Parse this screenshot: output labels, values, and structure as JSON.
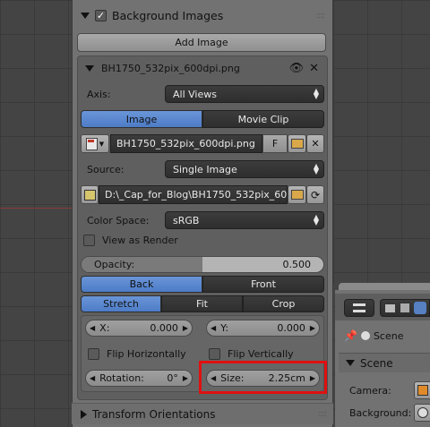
{
  "background_images": {
    "title": "Background Images",
    "add_image_label": "Add Image",
    "image_entry": {
      "filename": "BH1750_532pix_600dpi.png",
      "axis_label": "Axis:",
      "axis_value": "All Views",
      "tab_image": "Image",
      "tab_movie_clip": "Movie Clip",
      "image_name": "BH1750_532pix_600dpi.png",
      "fake_user_label": "F",
      "source_label": "Source:",
      "source_value": "Single Image",
      "filepath": "D:\\_Cap_for_Blog\\BH1750_532pix_600...",
      "color_space_label": "Color Space:",
      "color_space_value": "sRGB",
      "view_as_render_label": "View as Render",
      "opacity_label": "Opacity:",
      "opacity_value": "0.500",
      "opacity_fraction": 0.5,
      "back_label": "Back",
      "front_label": "Front",
      "stretch_label": "Stretch",
      "fit_label": "Fit",
      "crop_label": "Crop",
      "x_label": "X:",
      "x_value": "0.000",
      "y_label": "Y:",
      "y_value": "0.000",
      "flip_h_label": "Flip Horizontally",
      "flip_v_label": "Flip Vertically",
      "rotation_label": "Rotation:",
      "rotation_value": "0°",
      "size_label": "Size:",
      "size_value": "2.25cm"
    }
  },
  "transform_orientations": {
    "title": "Transform Orientations"
  },
  "properties": {
    "scene_tab_label": "Scene",
    "scene_section_title": "Scene",
    "camera_label": "Camera:",
    "background_label": "Background:"
  },
  "colors": {
    "accent_blue": "#5680c2",
    "highlight_red": "#e01010",
    "panel_gray": "#727272"
  }
}
